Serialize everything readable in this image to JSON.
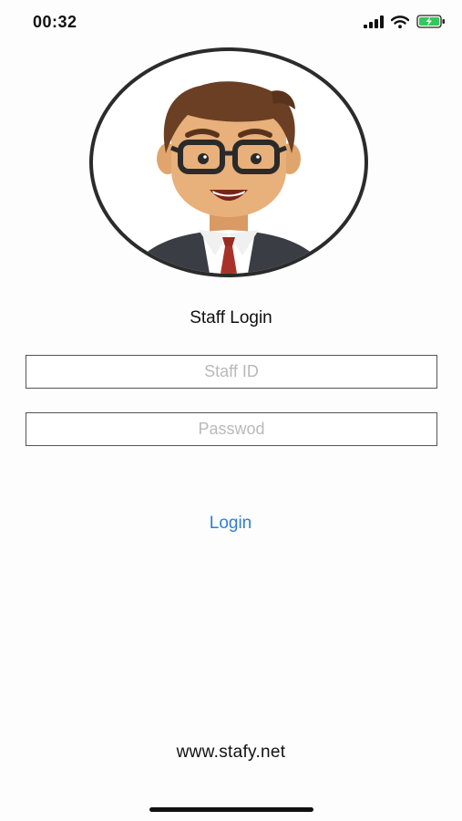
{
  "status_bar": {
    "time": "00:32",
    "icons": [
      "signal-icon",
      "wifi-icon",
      "battery-charging-icon"
    ]
  },
  "login": {
    "title": "Staff Login",
    "staff_id_placeholder": "Staff ID",
    "staff_id_value": "",
    "password_placeholder": "Passwod",
    "password_value": "",
    "login_label": "Login"
  },
  "footer": {
    "website": "www.stafy.net"
  },
  "colors": {
    "accent": "#2e7fd6",
    "battery": "#34c759",
    "border": "#555555"
  }
}
